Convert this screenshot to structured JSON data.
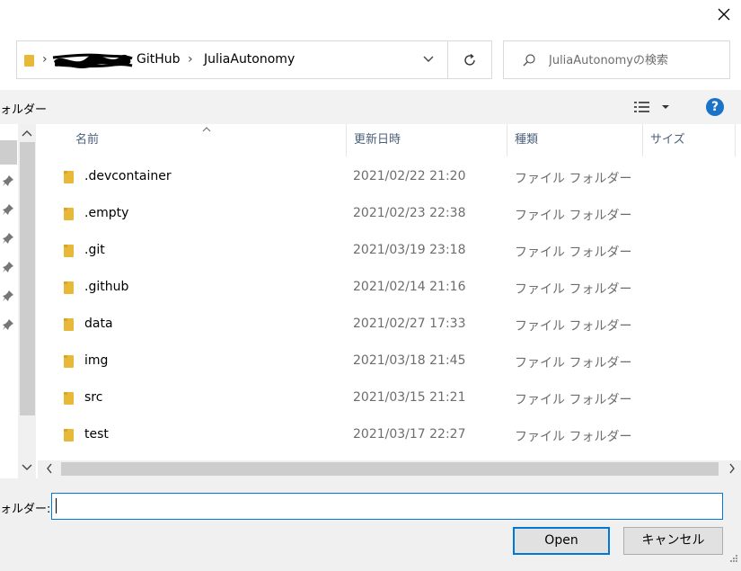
{
  "window": {
    "close_icon": "close-icon"
  },
  "address": {
    "crumbs": [
      "GitHub",
      "JuliaAutonomy"
    ],
    "separator": "›"
  },
  "search": {
    "placeholder": "JuliaAutonomyの検索"
  },
  "toolbar": {
    "new_folder_label": "ォルダー",
    "help_label": "?"
  },
  "columns": {
    "name": "名前",
    "date": "更新日時",
    "type": "種類",
    "size": "サイズ"
  },
  "files": [
    {
      "name": ".devcontainer",
      "date": "2021/02/22 21:20",
      "type": "ファイル フォルダー"
    },
    {
      "name": ".empty",
      "date": "2021/02/23 22:38",
      "type": "ファイル フォルダー"
    },
    {
      "name": ".git",
      "date": "2021/03/19 23:18",
      "type": "ファイル フォルダー"
    },
    {
      "name": ".github",
      "date": "2021/02/14 21:16",
      "type": "ファイル フォルダー"
    },
    {
      "name": "data",
      "date": "2021/02/27 17:33",
      "type": "ファイル フォルダー"
    },
    {
      "name": "img",
      "date": "2021/03/18 21:45",
      "type": "ファイル フォルダー"
    },
    {
      "name": "src",
      "date": "2021/03/15 21:21",
      "type": "ファイル フォルダー"
    },
    {
      "name": "test",
      "date": "2021/03/17 22:27",
      "type": "ファイル フォルダー"
    }
  ],
  "footer": {
    "folder_label": "ォルダー:",
    "folder_value": "",
    "open_label": "Open",
    "cancel_label": "キャンセル"
  },
  "colors": {
    "accent": "#0078d7",
    "folder": "#e8b938",
    "help_bg": "#1a73c9"
  }
}
